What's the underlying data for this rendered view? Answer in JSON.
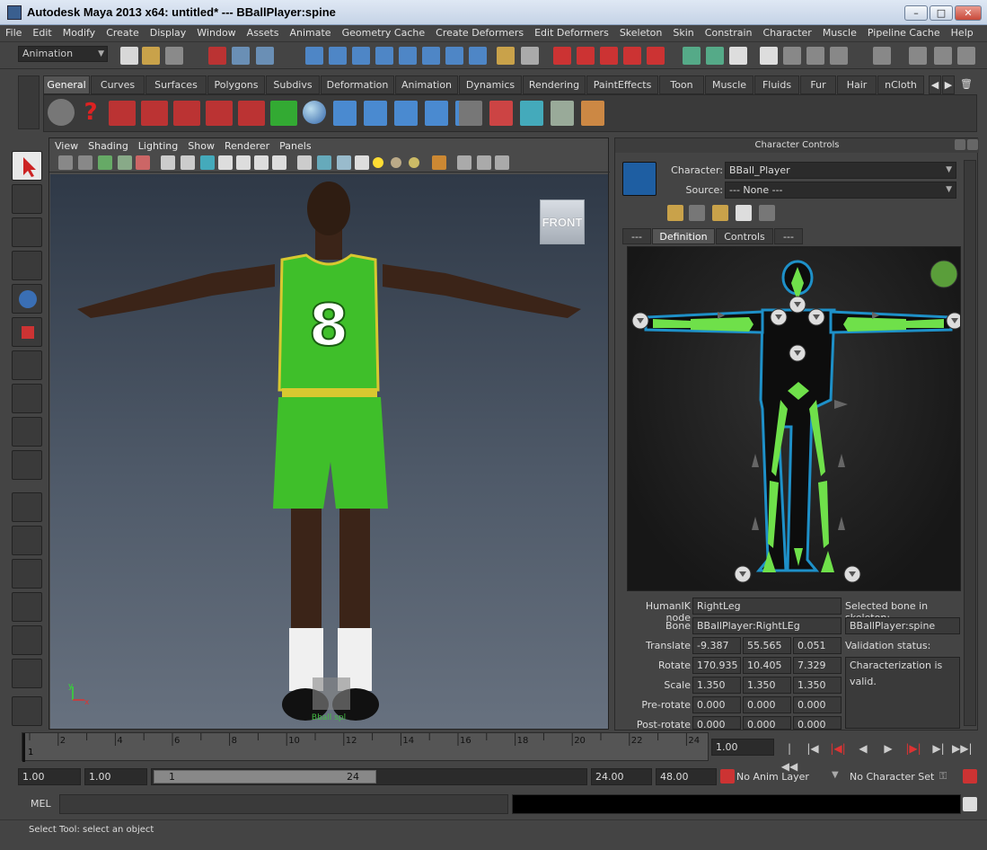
{
  "window": {
    "title": "Autodesk Maya 2013 x64: untitled*   ---   BBallPlayer:spine"
  },
  "menubar": [
    "File",
    "Edit",
    "Modify",
    "Create",
    "Display",
    "Window",
    "Assets",
    "Animate",
    "Geometry Cache",
    "Create Deformers",
    "Edit Deformers",
    "Skeleton",
    "Skin",
    "Constrain",
    "Character",
    "Muscle",
    "Pipeline Cache",
    "Help"
  ],
  "statusline": {
    "menuset": "Animation"
  },
  "shelf": {
    "tabs": [
      "General",
      "Curves",
      "Surfaces",
      "Polygons",
      "Subdivs",
      "Deformation",
      "Animation",
      "Dynamics",
      "Rendering",
      "PaintEffects",
      "Toon",
      "Muscle",
      "Fluids",
      "Fur",
      "Hair",
      "nCloth"
    ],
    "active": "General"
  },
  "viewport": {
    "menu": [
      "View",
      "Shading",
      "Lighting",
      "Show",
      "Renderer",
      "Panels"
    ],
    "cube_label": "FRONT",
    "jersey_number": "8",
    "axis_y": "y",
    "axis_x": "x",
    "floor_label": "Bball spl"
  },
  "character_controls": {
    "title": "Character Controls",
    "character_label": "Character:",
    "character_value": "BBall_Player",
    "source_label": "Source:",
    "source_value": "--- None ---",
    "tabs": [
      "---",
      "Definition",
      "Controls",
      "---"
    ],
    "active_tab": "Definition",
    "humanik_node_label": "HumanIK node",
    "humanik_node_value": "RightLeg",
    "selected_bone_label": "Selected bone in skeleton:",
    "bone_label": "Bone",
    "bone_value": "BBallPlayer:RightLEg",
    "selected_bone_value": "BBallPlayer:spine",
    "translate_label": "Translate",
    "translate": [
      "-9.387",
      "55.565",
      "0.051"
    ],
    "validation_label": "Validation status:",
    "rotate_label": "Rotate",
    "rotate": [
      "170.935",
      "10.405",
      "7.329"
    ],
    "validation_value": "Characterization is valid.",
    "scale_label": "Scale",
    "scale": [
      "1.350",
      "1.350",
      "1.350"
    ],
    "prerotate_label": "Pre-rotate",
    "prerotate": [
      "0.000",
      "0.000",
      "0.000"
    ],
    "postrotate_label": "Post-rotate",
    "postrotate": [
      "0.000",
      "0.000",
      "0.000"
    ],
    "status_color": "#5a9e3a"
  },
  "timeline": {
    "ticks": [
      "2",
      "4",
      "6",
      "8",
      "10",
      "12",
      "14",
      "16",
      "18",
      "20",
      "22",
      "24"
    ],
    "start_marker": "1",
    "current_time": "1.00"
  },
  "range": {
    "start_time": "1.00",
    "playback_start": "1.00",
    "slider_start": "1",
    "slider_end": "24",
    "playback_end": "24.00",
    "end_time": "48.00",
    "anim_layer": "No Anim Layer",
    "character_set": "No Character Set"
  },
  "mel": {
    "label": "MEL"
  },
  "helpline": {
    "text": "Select Tool: select an object"
  },
  "colors": {
    "jersey": "#3fbf2a",
    "trim": "#d8c830",
    "hik_bone": "#6fe04a",
    "hik_outline": "#1e90c8"
  }
}
